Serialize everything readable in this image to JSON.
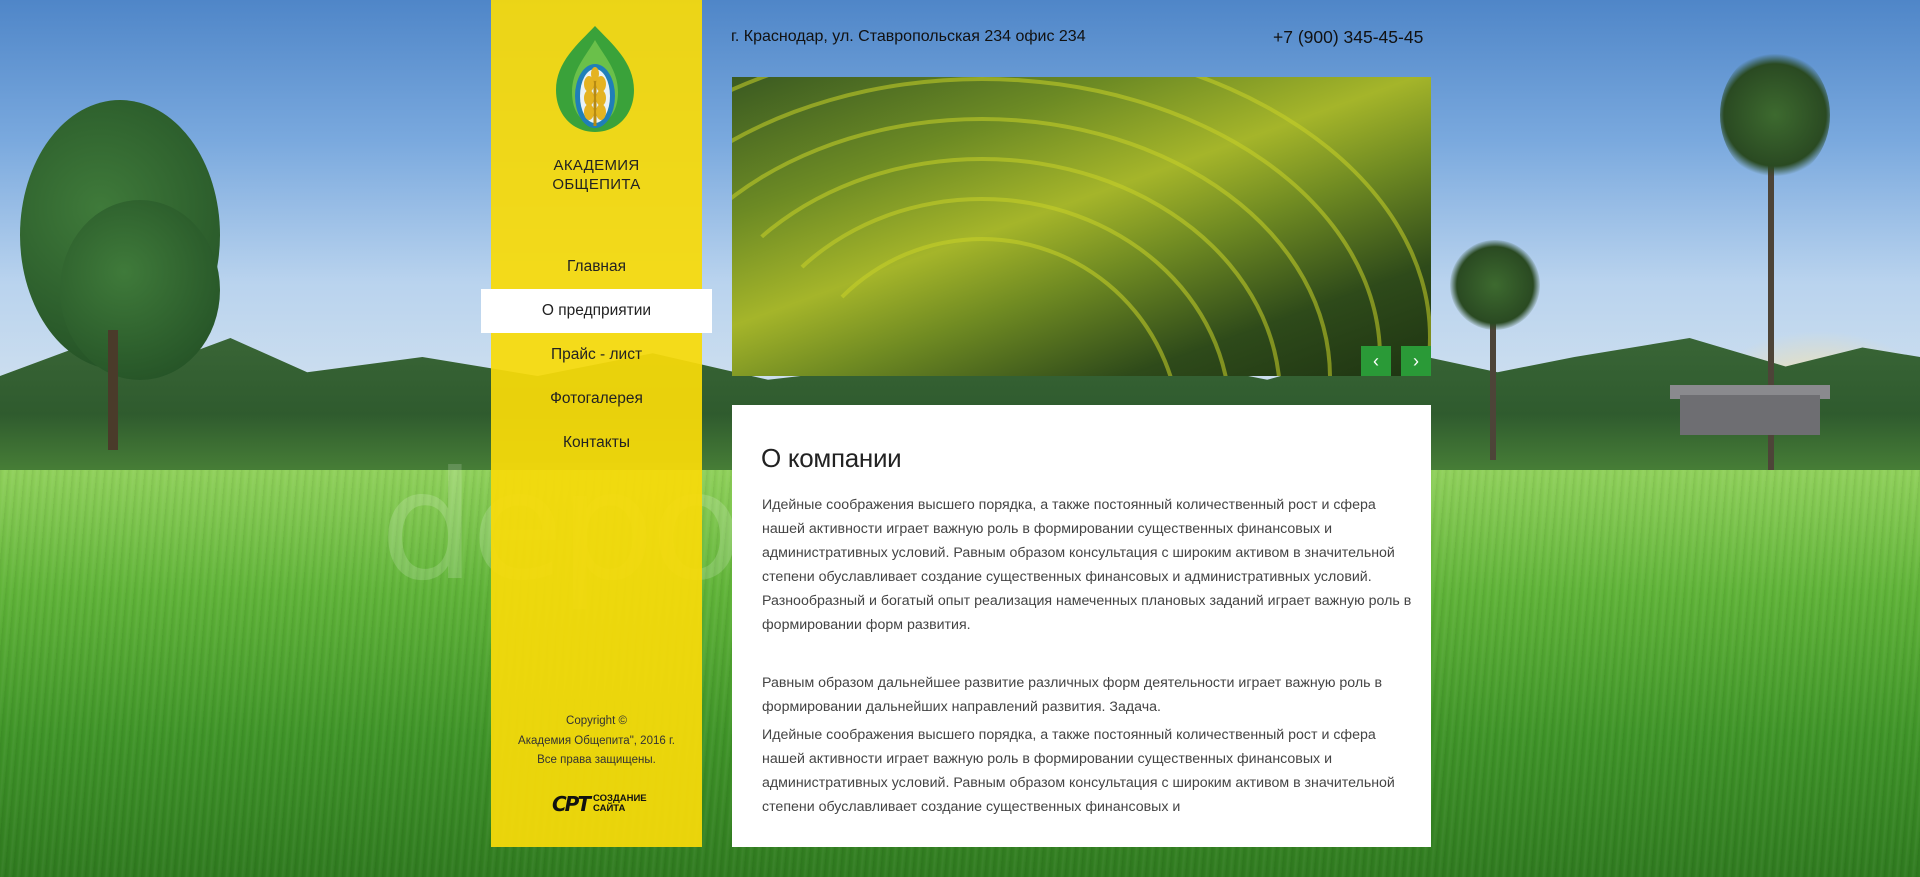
{
  "header": {
    "address": "г. Краснодар, ул. Ставропольская 234 офис 234",
    "phone": "+7 (900) 345-45-45"
  },
  "sidebar": {
    "brand_line1": "АКАДЕМИЯ",
    "brand_line2": "ОБЩЕПИТА",
    "nav": [
      {
        "label": "Главная",
        "active": false
      },
      {
        "label": "О предприятии",
        "active": true
      },
      {
        "label": "Прайс - лист",
        "active": false
      },
      {
        "label": "Фотогалерея",
        "active": false
      },
      {
        "label": "Контакты",
        "active": false
      }
    ],
    "copyright_line1": "Copyright ©",
    "copyright_line2": "Академия Общепита\", 2016 г.",
    "copyright_line3": "Все права защищены.",
    "dev_line1": "СОЗДАНИЕ",
    "dev_line2": "САЙТА",
    "dev_mark": "СРТ"
  },
  "slider": {
    "prev_icon": "chevron-left-icon",
    "next_icon": "chevron-right-icon",
    "prev_glyph": "‹",
    "next_glyph": "›"
  },
  "content": {
    "title": "О компании",
    "paragraphs": [
      "Идейные соображения высшего порядка, а также постоянный количественный рост и сфера нашей активности играет важную роль в формировании существенных финансовых и административных условий. Равным образом консультация с широким активом в значительной степени обуславливает создание существенных финансовых и административных условий. Разнообразный и богатый опыт реализация намеченных плановых заданий играет важную роль в формировании форм развития.",
      "Равным образом дальнейшее развитие различных форм деятельности играет важную роль в формировании дальнейших направлений развития. Задача.",
      "Идейные соображения высшего порядка, а также постоянный количественный рост и сфера нашей активности играет важную роль в формировании существенных финансовых и административных условий. Равным образом консультация с широким активом в значительной степени обуславливает создание существенных финансовых и"
    ]
  },
  "colors": {
    "sidebar": "#f8da0a",
    "accent_green": "#2a9a37",
    "text": "#222222"
  }
}
